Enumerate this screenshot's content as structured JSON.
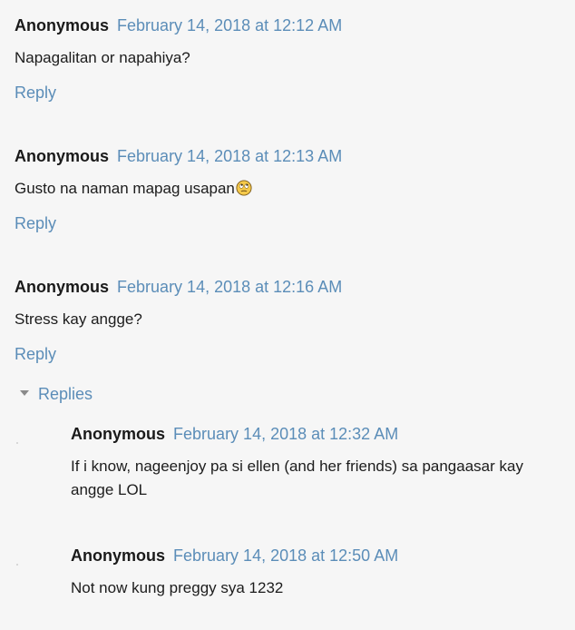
{
  "comments": [
    {
      "author": "Anonymous",
      "timestamp": "February 14, 2018 at 12:12 AM",
      "body": "Napagalitan or napahiya?",
      "reply_label": "Reply"
    },
    {
      "author": "Anonymous",
      "timestamp": "February 14, 2018 at 12:13 AM",
      "body": "Gusto na naman mapag usapan",
      "emoji": "rolling-eyes-emoji",
      "reply_label": "Reply"
    },
    {
      "author": "Anonymous",
      "timestamp": "February 14, 2018 at 12:16 AM",
      "body": "Stress kay angge?",
      "reply_label": "Reply"
    }
  ],
  "replies": {
    "toggle_label": "Replies",
    "items": [
      {
        "author": "Anonymous",
        "timestamp": "February 14, 2018 at 12:32 AM",
        "body": "If i know, nageenjoy pa si ellen (and her friends) sa pangaasar kay angge LOL"
      },
      {
        "author": "Anonymous",
        "timestamp": "February 14, 2018 at 12:50 AM",
        "body": "Not now kung preggy sya 1232"
      }
    ]
  },
  "colors": {
    "link": "#5b8db8",
    "background": "#f6f6f6",
    "text": "#1c1c1c"
  }
}
